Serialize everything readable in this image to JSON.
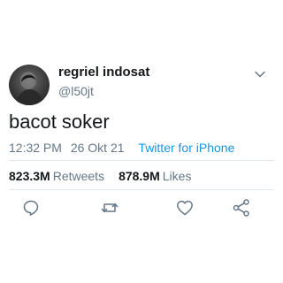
{
  "author": {
    "display_name": "regriel indosat",
    "handle": "@l50jt",
    "avatar_icon": "profile-photo"
  },
  "tweet": {
    "text": "bacot soker",
    "time": "12:32 PM",
    "date": "26 Okt 21",
    "source": "Twitter for iPhone"
  },
  "stats": {
    "retweets_count": "823.3M",
    "retweets_label": "Retweets",
    "likes_count": "878.9M",
    "likes_label": "Likes"
  },
  "actions": [
    {
      "icon": "reply-icon"
    },
    {
      "icon": "retweet-icon"
    },
    {
      "icon": "like-icon"
    },
    {
      "icon": "share-icon"
    }
  ],
  "colors": {
    "text_primary": "#14171a",
    "text_secondary": "#657786",
    "link": "#1b95e0",
    "divider": "#e1e8ed",
    "icon": "#657786"
  }
}
